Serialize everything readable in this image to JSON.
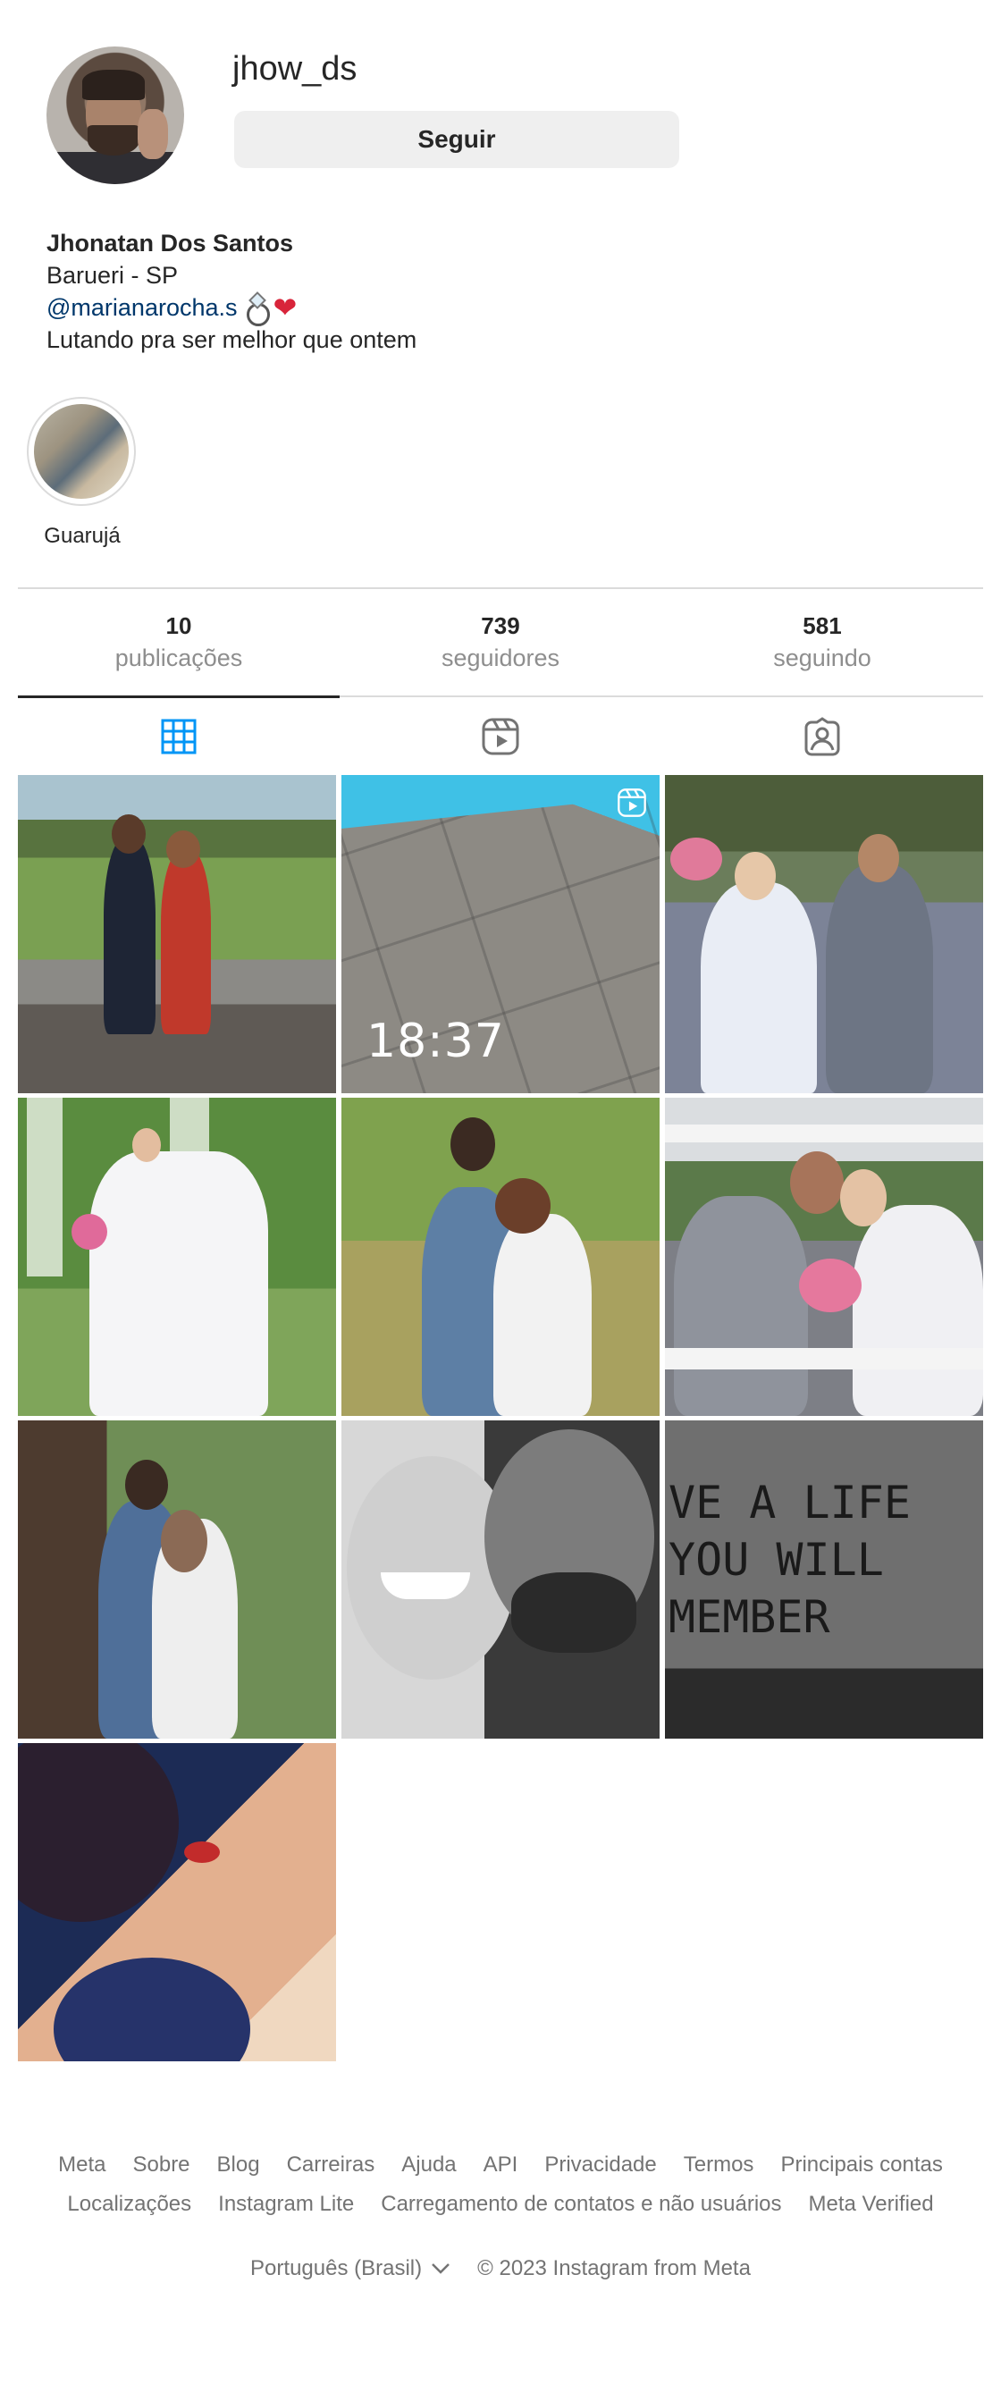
{
  "profile": {
    "username": "jhow_ds",
    "follow_label": "Seguir",
    "name": "Jhonatan Dos Santos",
    "location": "Barueri - SP",
    "mention": "@marianarocha.s",
    "motto": "Lutando pra ser melhor que ontem"
  },
  "highlights": [
    {
      "label": "Guarujá"
    }
  ],
  "stats": [
    {
      "value": "10",
      "label": "publicações"
    },
    {
      "value": "739",
      "label": "seguidores"
    },
    {
      "value": "581",
      "label": "seguindo"
    }
  ],
  "tabs": [
    {
      "icon": "grid-icon",
      "active": true
    },
    {
      "icon": "reels-icon",
      "active": false
    },
    {
      "icon": "tagged-icon",
      "active": false
    }
  ],
  "posts": {
    "reel_time_text": "18:37",
    "graffiti_text": "VE A LIFE\nYOU WILL\nMEMBER"
  },
  "footer": {
    "links": [
      "Meta",
      "Sobre",
      "Blog",
      "Carreiras",
      "Ajuda",
      "API",
      "Privacidade",
      "Termos",
      "Principais contas",
      "Localizações",
      "Instagram Lite",
      "Carregamento de contatos e não usuários",
      "Meta Verified"
    ],
    "language": "Português (Brasil)",
    "copyright": "© 2023 Instagram from Meta"
  },
  "colors": {
    "accent_tab": "#0095f6",
    "link": "#00376b",
    "muted": "#8e8e8e"
  }
}
